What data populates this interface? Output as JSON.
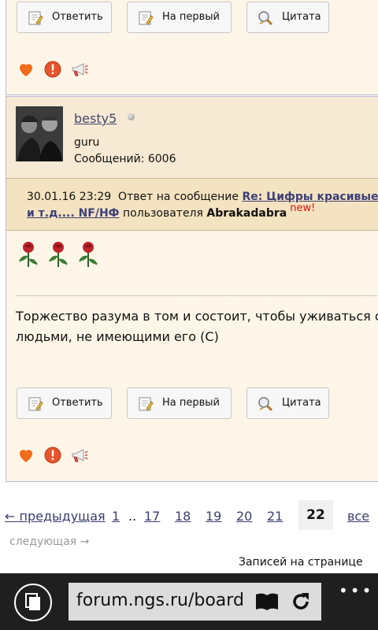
{
  "colors": {
    "post_bg": "#fdf6e8",
    "header_bg": "#f7ead4",
    "reply_bg": "#f4e3c0",
    "link": "#44486f",
    "new": "#e01010",
    "appbar": "#1f1f1f"
  },
  "post_top": {
    "buttons": [
      {
        "label": "Ответить",
        "icon": "reply-icon"
      },
      {
        "label": "На первый",
        "icon": "edit-icon"
      },
      {
        "label": "Цитата",
        "icon": "quote-icon"
      }
    ],
    "actions": [
      "heart-icon",
      "alert-icon",
      "megaphone-icon"
    ]
  },
  "post": {
    "username": "besty5",
    "rank": "guru",
    "posts_count": "Сообщений: 6006",
    "reply": {
      "date": "30.01.16 23:29",
      "intro": "Ответ на сообщение",
      "title_line1": "Re: Цифры красивые.",
      "title_line2": "и т.д.... NF/НФ",
      "by": "пользователя",
      "author": "Abrakadabra",
      "new_label": "new!"
    },
    "text_line1": "Торжество разума в том и состоит, чтобы уживаться с",
    "text_line2": "людьми, не имеющими его (С)",
    "buttons": [
      {
        "label": "Ответить",
        "icon": "reply-icon"
      },
      {
        "label": "На первый",
        "icon": "edit-icon"
      },
      {
        "label": "Цитата",
        "icon": "quote-icon"
      }
    ]
  },
  "pagination": {
    "prev": "← предыдущая",
    "pages": [
      "1",
      "17",
      "18",
      "19",
      "20",
      "21"
    ],
    "ellipsis": "..",
    "current": "22",
    "all": "все",
    "next": "следующая →",
    "per_page": "Записей на странице"
  },
  "browser": {
    "url": "forum.ngs.ru/board",
    "more": "•••"
  }
}
